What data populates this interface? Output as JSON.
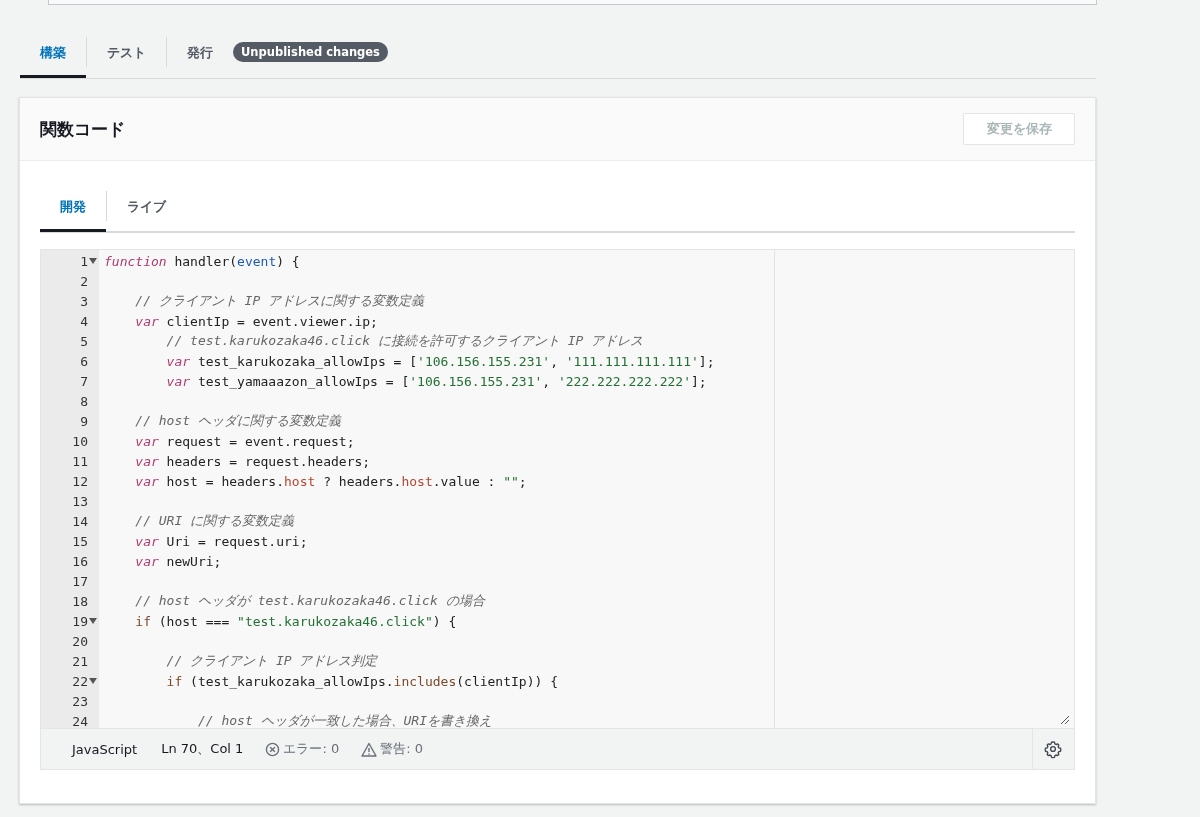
{
  "tabs": [
    {
      "label": "構築",
      "selected": true
    },
    {
      "label": "テスト",
      "selected": false
    },
    {
      "label": "発行",
      "selected": false,
      "badge": "Unpublished changes"
    }
  ],
  "panel": {
    "title": "関数コード",
    "save_button": {
      "label": "変更を保存",
      "disabled": true
    },
    "tabs": [
      {
        "label": "開発",
        "selected": true
      },
      {
        "label": "ライブ",
        "selected": false
      }
    ],
    "editor": {
      "lines": [
        {
          "number": "1",
          "fold": true,
          "tokens": [
            {
              "kind": "keyword",
              "text": "function"
            },
            {
              "kind": "plain",
              "text": " handler("
            },
            {
              "kind": "param",
              "text": "event"
            },
            {
              "kind": "plain",
              "text": ") {"
            }
          ]
        },
        {
          "number": "2",
          "fold": false
        },
        {
          "number": "3",
          "fold": false,
          "tokens": [
            {
              "kind": "comment",
              "text": "    // クライアント IP アドレスに関する変数定義"
            }
          ]
        },
        {
          "number": "4",
          "fold": false,
          "tokens": [
            {
              "kind": "keyword",
              "text": "    var"
            },
            {
              "kind": "plain",
              "text": " clientIp = event.viewer.ip;"
            }
          ]
        },
        {
          "number": "5",
          "fold": false,
          "tokens": [
            {
              "kind": "comment",
              "text": "        // test.karukozaka46.click に接続を許可するクライアント IP アドレス"
            }
          ]
        },
        {
          "number": "6",
          "fold": false,
          "tokens": [
            {
              "kind": "keyword",
              "text": "        var"
            },
            {
              "kind": "plain",
              "text": " test_karukozaka_allowIps = ["
            },
            {
              "kind": "string",
              "text": "'106.156.155.231'"
            },
            {
              "kind": "plain",
              "text": ", "
            },
            {
              "kind": "string",
              "text": "'111.111.111.111'"
            },
            {
              "kind": "plain",
              "text": "];"
            }
          ]
        },
        {
          "number": "7",
          "fold": false,
          "tokens": [
            {
              "kind": "keyword",
              "text": "        var"
            },
            {
              "kind": "plain",
              "text": " test_yamaaazon_allowIps = ["
            },
            {
              "kind": "string",
              "text": "'106.156.155.231'"
            },
            {
              "kind": "plain",
              "text": ", "
            },
            {
              "kind": "string",
              "text": "'222.222.222.222'"
            },
            {
              "kind": "plain",
              "text": "];"
            }
          ]
        },
        {
          "number": "8",
          "fold": false
        },
        {
          "number": "9",
          "fold": false,
          "tokens": [
            {
              "kind": "comment",
              "text": "    // host ヘッダに関する変数定義"
            }
          ]
        },
        {
          "number": "10",
          "fold": false,
          "tokens": [
            {
              "kind": "keyword",
              "text": "    var"
            },
            {
              "kind": "plain",
              "text": " request = event.request;"
            }
          ]
        },
        {
          "number": "11",
          "fold": false,
          "tokens": [
            {
              "kind": "keyword",
              "text": "    var"
            },
            {
              "kind": "plain",
              "text": " headers = request.headers;"
            }
          ]
        },
        {
          "number": "12",
          "fold": false,
          "tokens": [
            {
              "kind": "keyword",
              "text": "    var"
            },
            {
              "kind": "plain",
              "text": " host = headers."
            },
            {
              "kind": "property",
              "text": "host"
            },
            {
              "kind": "plain",
              "text": " ? headers."
            },
            {
              "kind": "property",
              "text": "host"
            },
            {
              "kind": "plain",
              "text": ".value : "
            },
            {
              "kind": "string",
              "text": "\"\""
            },
            {
              "kind": "plain",
              "text": ";"
            }
          ]
        },
        {
          "number": "13",
          "fold": false
        },
        {
          "number": "14",
          "fold": false,
          "tokens": [
            {
              "kind": "comment",
              "text": "    // URI に関する変数定義"
            }
          ]
        },
        {
          "number": "15",
          "fold": false,
          "tokens": [
            {
              "kind": "keyword",
              "text": "    var"
            },
            {
              "kind": "plain",
              "text": " Uri = request.uri;"
            }
          ]
        },
        {
          "number": "16",
          "fold": false,
          "tokens": [
            {
              "kind": "keyword",
              "text": "    var"
            },
            {
              "kind": "plain",
              "text": " newUri;"
            }
          ]
        },
        {
          "number": "17",
          "fold": false
        },
        {
          "number": "18",
          "fold": false,
          "tokens": [
            {
              "kind": "comment",
              "text": "    // host ヘッダが test.karukozaka46.click の場合"
            }
          ]
        },
        {
          "number": "19",
          "fold": true,
          "tokens": [
            {
              "kind": "control",
              "text": "    if"
            },
            {
              "kind": "plain",
              "text": " (host === "
            },
            {
              "kind": "string",
              "text": "\"test.karukozaka46.click\""
            },
            {
              "kind": "plain",
              "text": ") {"
            }
          ]
        },
        {
          "number": "20",
          "fold": false
        },
        {
          "number": "21",
          "fold": false,
          "tokens": [
            {
              "kind": "comment",
              "text": "        // クライアント IP アドレス判定"
            }
          ]
        },
        {
          "number": "22",
          "fold": true,
          "tokens": [
            {
              "kind": "control",
              "text": "        if"
            },
            {
              "kind": "plain",
              "text": " (test_karukozaka_allowIps."
            },
            {
              "kind": "method",
              "text": "includes"
            },
            {
              "kind": "plain",
              "text": "(clientIp)) {"
            }
          ]
        },
        {
          "number": "23",
          "fold": false
        },
        {
          "number": "24",
          "fold": false,
          "tokens": [
            {
              "kind": "comment",
              "text": "            // host ヘッダが一致した場合、URIを書き換え"
            }
          ]
        }
      ],
      "status": {
        "language": "JavaScript",
        "position": "Ln 70、Col 1",
        "errors": "エラー: 0",
        "warnings": "警告: 0"
      }
    }
  }
}
